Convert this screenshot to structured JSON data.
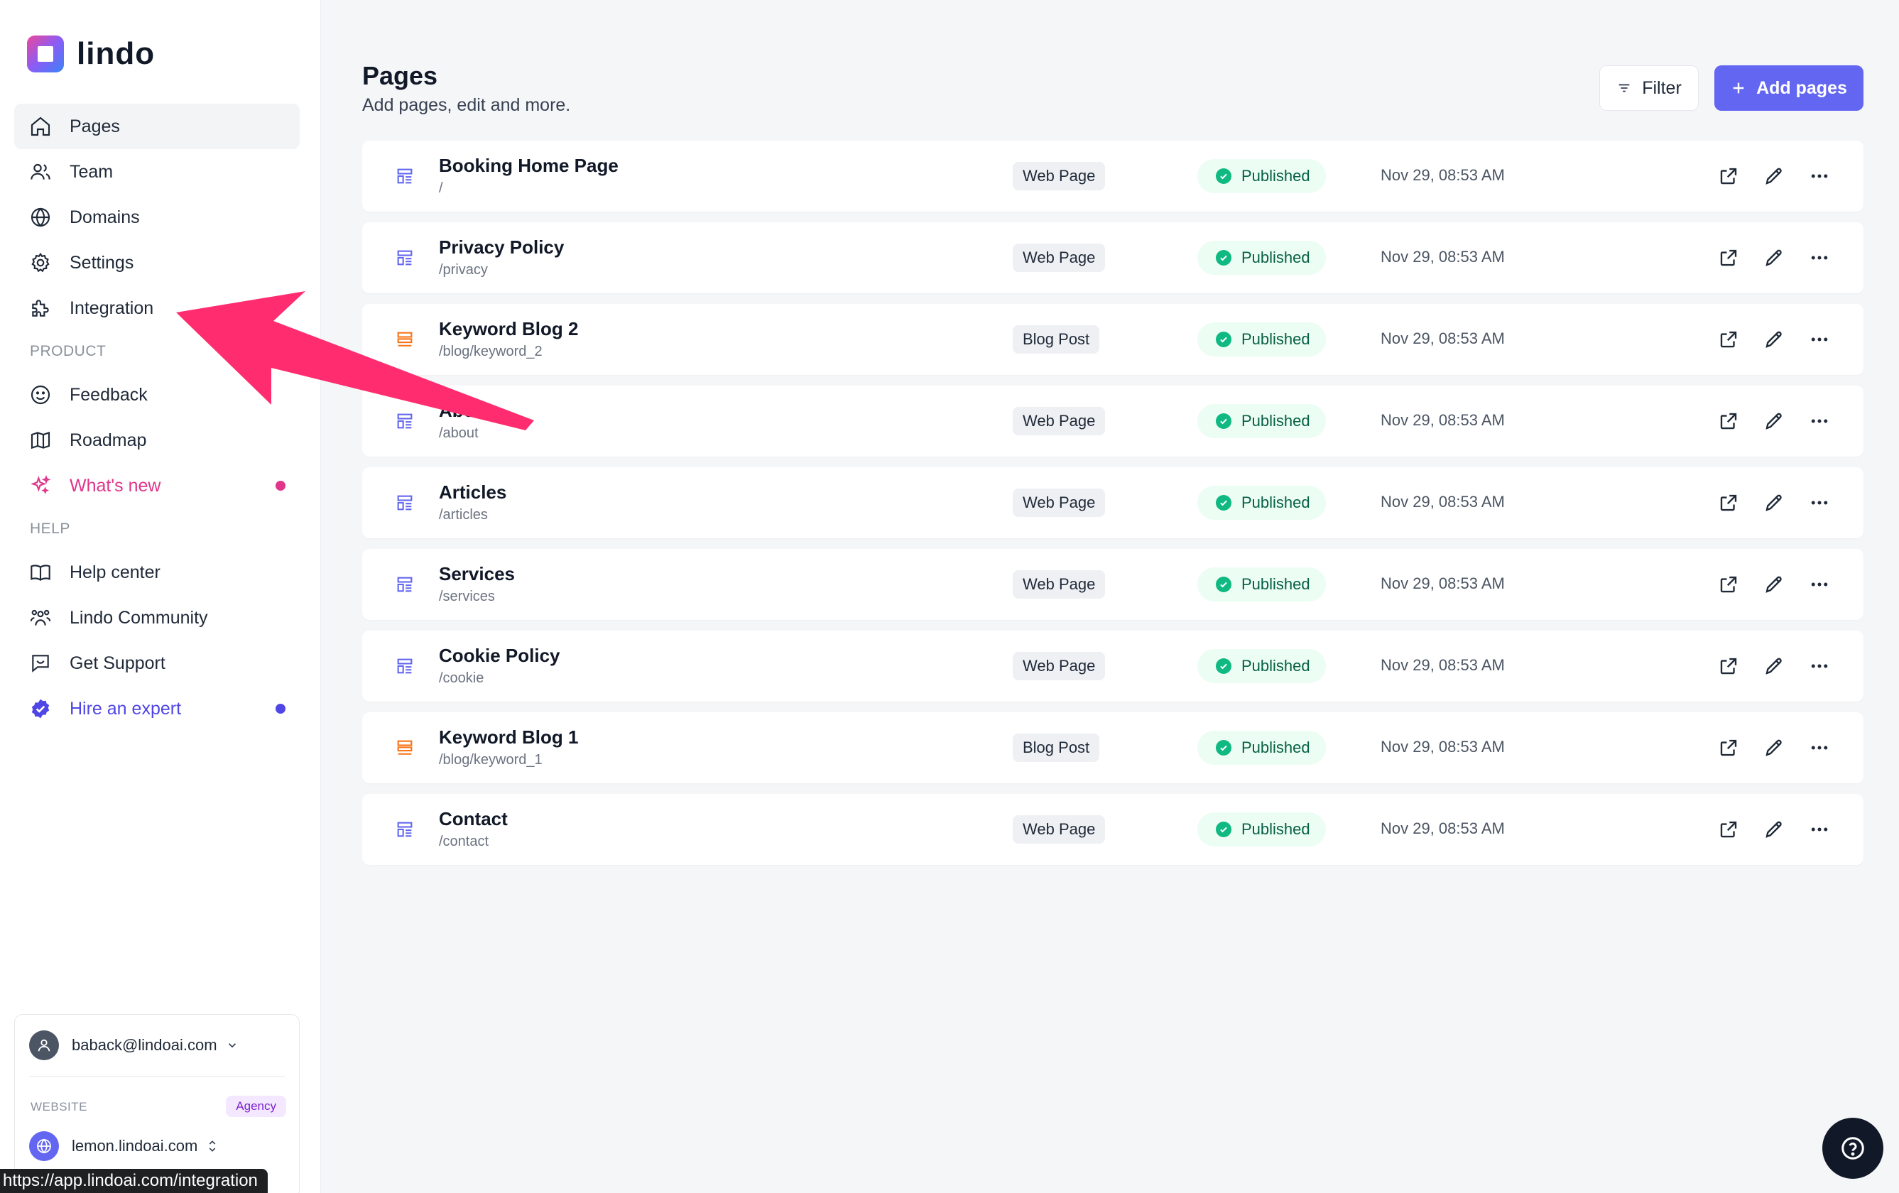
{
  "app": {
    "name": "lindo"
  },
  "sidebar": {
    "items": [
      {
        "label": "Pages",
        "icon": "home-icon",
        "active": true
      },
      {
        "label": "Team",
        "icon": "users-icon"
      },
      {
        "label": "Domains",
        "icon": "globe-icon"
      },
      {
        "label": "Settings",
        "icon": "gear-icon"
      },
      {
        "label": "Integration",
        "icon": "puzzle-icon"
      }
    ],
    "product_section": "PRODUCT",
    "product_items": [
      {
        "label": "Feedback",
        "icon": "smile-icon"
      },
      {
        "label": "Roadmap",
        "icon": "map-icon"
      },
      {
        "label": "What's new",
        "icon": "sparkles-icon",
        "color": "#e0358a",
        "dot_color": "#e0358a"
      }
    ],
    "help_section": "HELP",
    "help_items": [
      {
        "label": "Help center",
        "icon": "book-icon"
      },
      {
        "label": "Lindo Community",
        "icon": "community-icon"
      },
      {
        "label": "Get Support",
        "icon": "chat-icon"
      },
      {
        "label": "Hire an expert",
        "icon": "verified-badge-icon",
        "color": "#4f46e5",
        "dot_color": "#4f46e5"
      }
    ],
    "account": {
      "email": "baback@lindoai.com",
      "website_label": "WEBSITE",
      "plan_badge": "Agency",
      "site": "lemon.lindoai.com"
    },
    "status_url": "https://app.lindoai.com/integration"
  },
  "main": {
    "title": "Pages",
    "subtitle": "Add pages, edit and more.",
    "filter_label": "Filter",
    "add_label": "Add pages",
    "accent_color": "#6366f1",
    "rows": [
      {
        "name": "Booking Home Page",
        "path": "/",
        "type": "Web Page",
        "status": "Published",
        "date": "Nov 29, 08:53 AM",
        "kind": "web"
      },
      {
        "name": "Privacy Policy",
        "path": "/privacy",
        "type": "Web Page",
        "status": "Published",
        "date": "Nov 29, 08:53 AM",
        "kind": "web"
      },
      {
        "name": "Keyword Blog 2",
        "path": "/blog/keyword_2",
        "type": "Blog Post",
        "status": "Published",
        "date": "Nov 29, 08:53 AM",
        "kind": "blog"
      },
      {
        "name": "About",
        "path": "/about",
        "type": "Web Page",
        "status": "Published",
        "date": "Nov 29, 08:53 AM",
        "kind": "web"
      },
      {
        "name": "Articles",
        "path": "/articles",
        "type": "Web Page",
        "status": "Published",
        "date": "Nov 29, 08:53 AM",
        "kind": "web"
      },
      {
        "name": "Services",
        "path": "/services",
        "type": "Web Page",
        "status": "Published",
        "date": "Nov 29, 08:53 AM",
        "kind": "web"
      },
      {
        "name": "Cookie Policy",
        "path": "/cookie",
        "type": "Web Page",
        "status": "Published",
        "date": "Nov 29, 08:53 AM",
        "kind": "web"
      },
      {
        "name": "Keyword Blog 1",
        "path": "/blog/keyword_1",
        "type": "Blog Post",
        "status": "Published",
        "date": "Nov 29, 08:53 AM",
        "kind": "blog"
      },
      {
        "name": "Contact",
        "path": "/contact",
        "type": "Web Page",
        "status": "Published",
        "date": "Nov 29, 08:53 AM",
        "kind": "web"
      }
    ]
  },
  "annotation": {
    "arrow_color": "#ff2d6f"
  }
}
